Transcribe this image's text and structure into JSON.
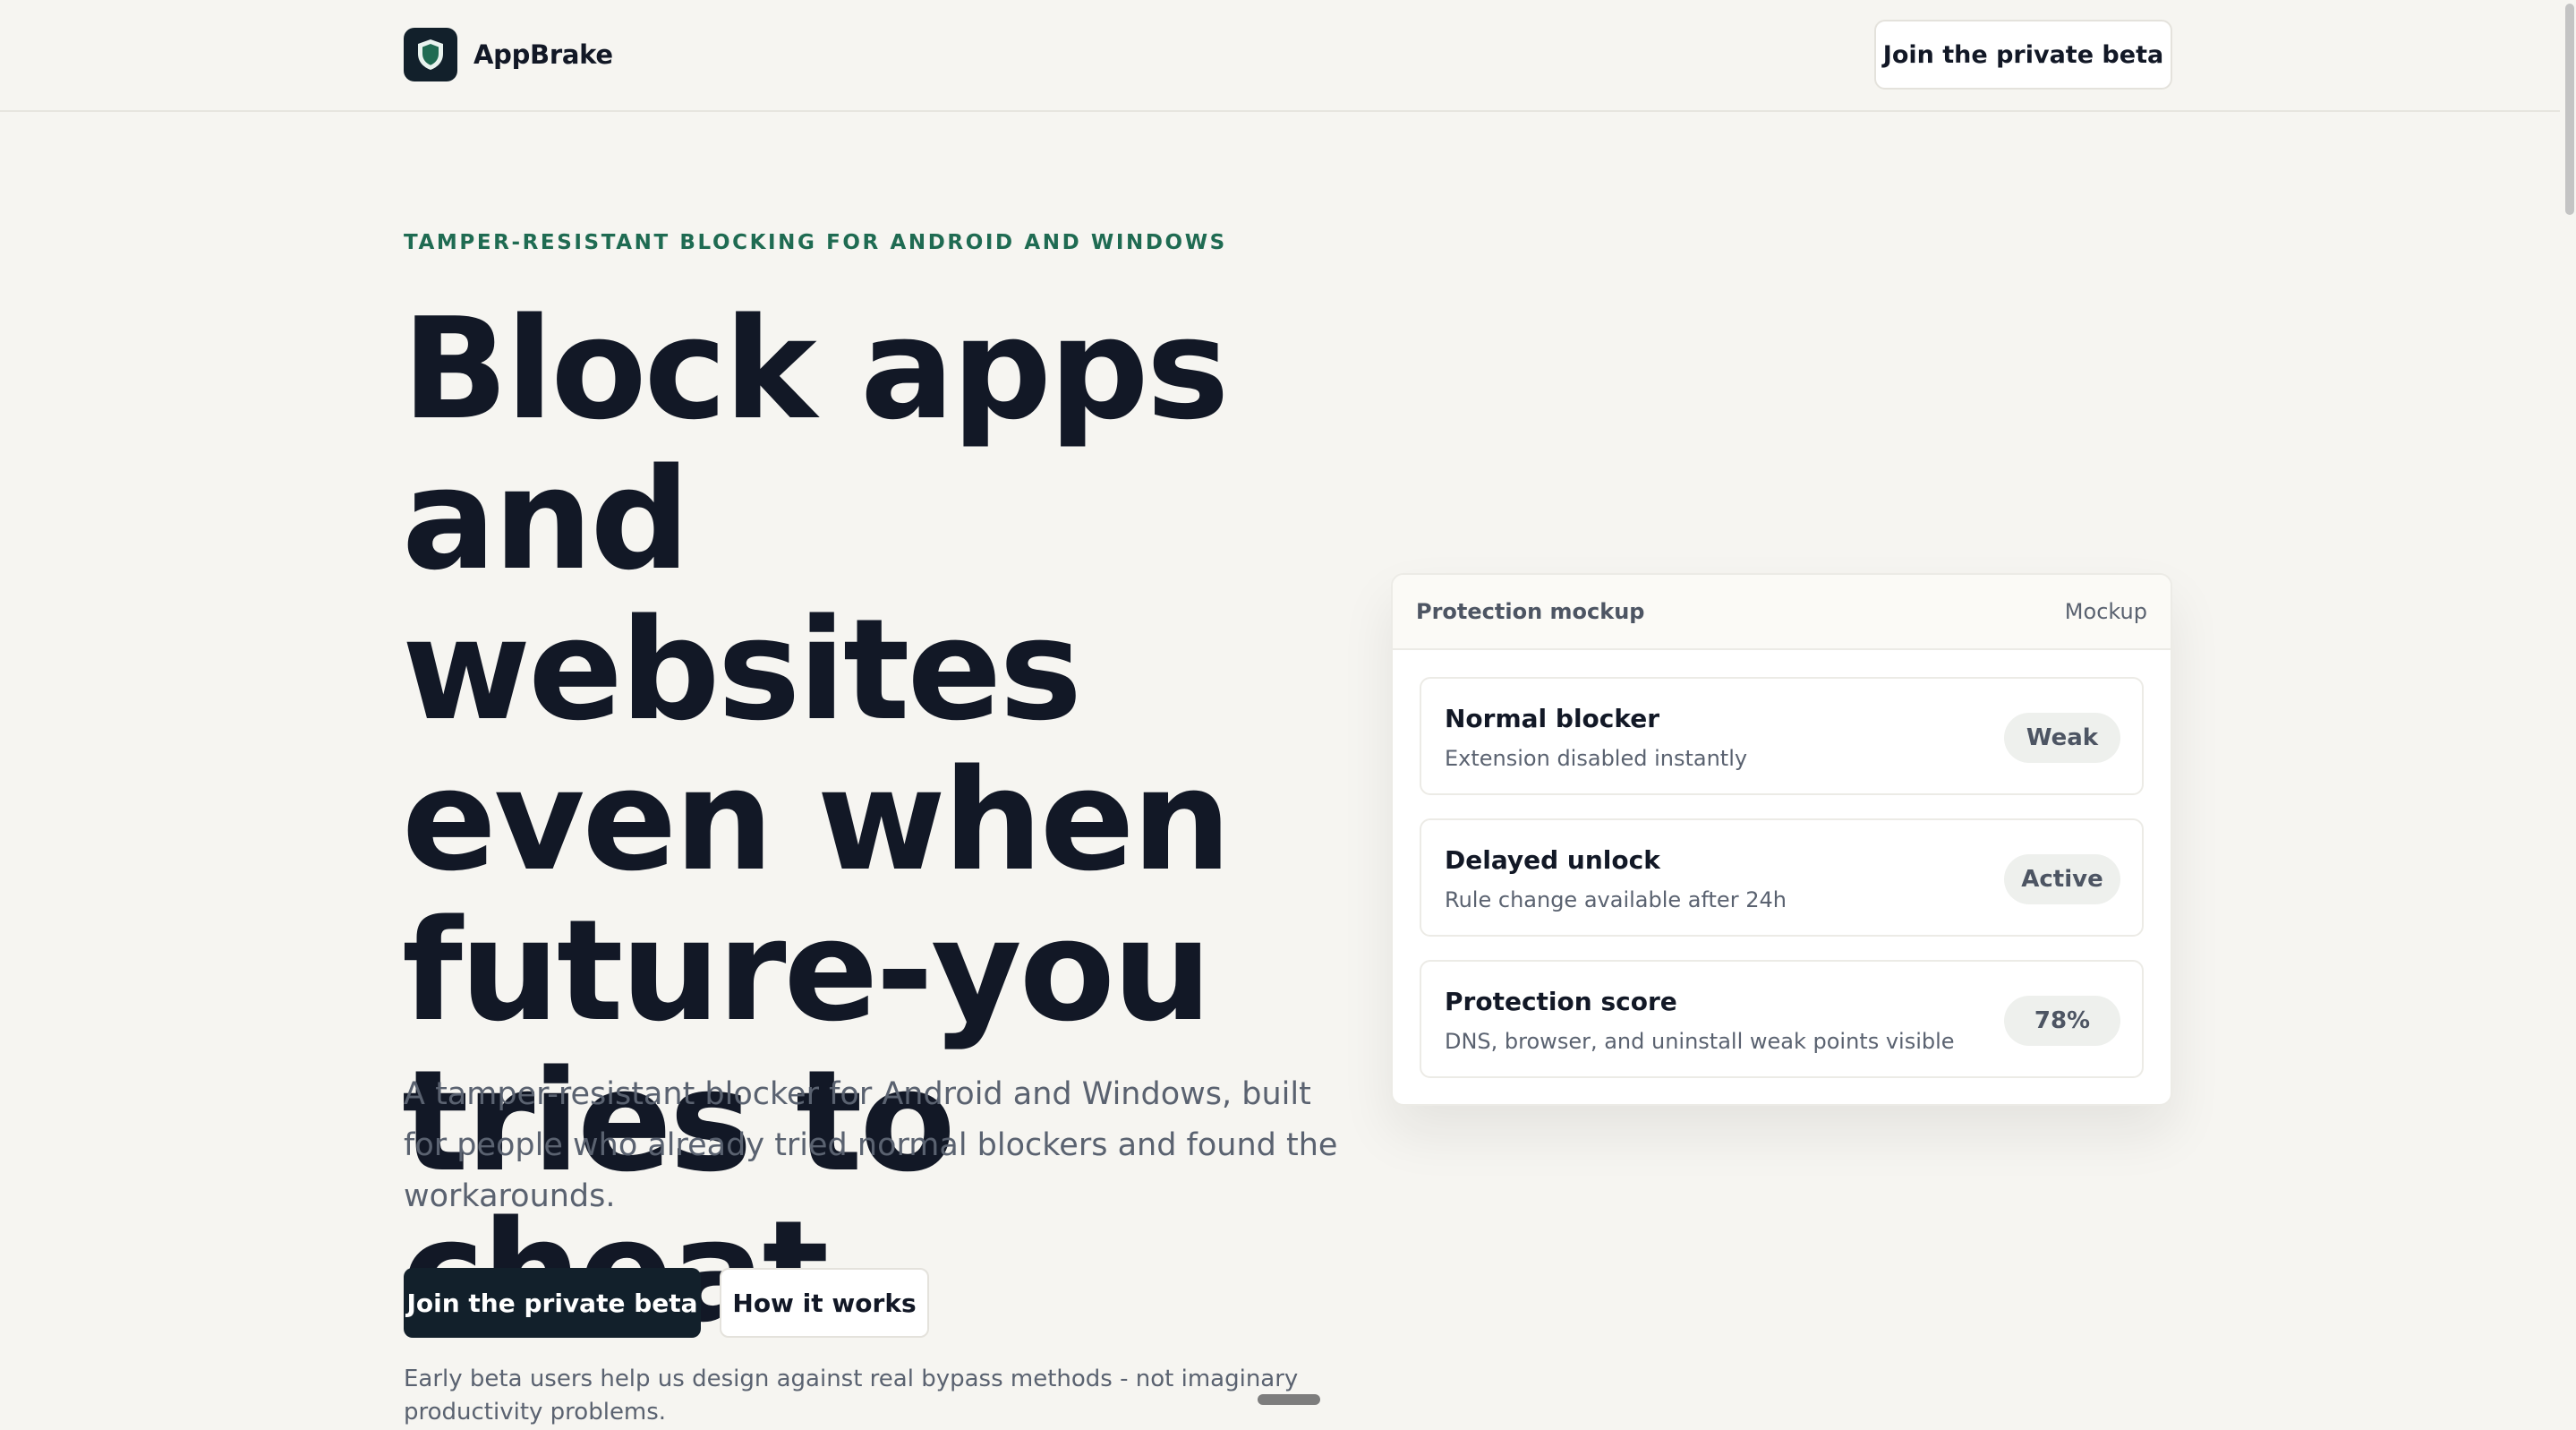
{
  "header": {
    "brand_name": "AppBrake",
    "logo_icon": "shield-icon",
    "cta_label": "Join the private beta"
  },
  "hero": {
    "eyebrow": "TAMPER-RESISTANT BLOCKING FOR ANDROID AND WINDOWS",
    "headline_lines": [
      "Block apps",
      "and websites",
      "even when",
      "future-you",
      "tries to cheat."
    ],
    "lead": "A tamper-resistant blocker for Android and Windows, built for people who already tried normal blockers and found the workarounds.",
    "primary_button": "Join the private beta",
    "secondary_button": "How it works",
    "note": "Early beta users help us design against real bypass methods - not imaginary productivity problems."
  },
  "mockup": {
    "title": "Protection mockup",
    "tag": "Mockup",
    "rows": [
      {
        "title": "Normal blocker",
        "subtitle": "Extension disabled instantly",
        "badge": "Weak"
      },
      {
        "title": "Delayed unlock",
        "subtitle": "Rule change available after 24h",
        "badge": "Active"
      },
      {
        "title": "Protection score",
        "subtitle": "DNS, browser, and uninstall weak points visible",
        "badge": "78%"
      }
    ]
  },
  "colors": {
    "background": "#f6f5f1",
    "accent": "#1f6b52",
    "dark": "#12202b",
    "text": "#121826",
    "muted": "#5a6270"
  }
}
